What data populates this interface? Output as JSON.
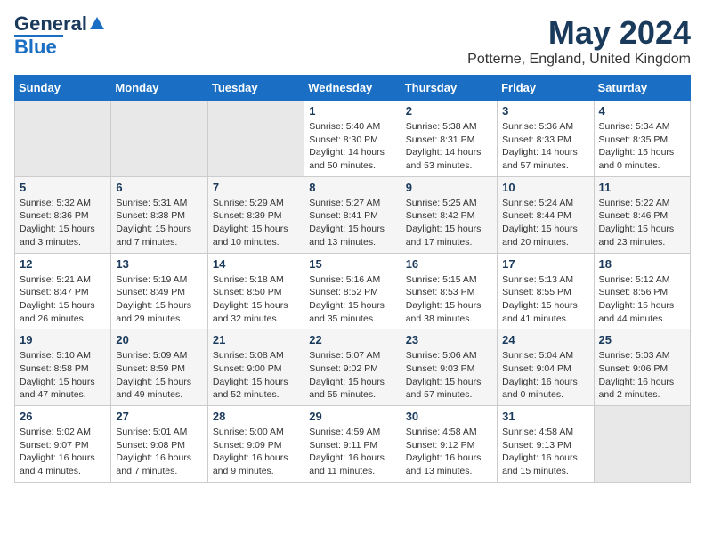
{
  "header": {
    "logo_line1": "General",
    "logo_line2": "Blue",
    "main_title": "May 2024",
    "subtitle": "Potterne, England, United Kingdom"
  },
  "calendar": {
    "days_of_week": [
      "Sunday",
      "Monday",
      "Tuesday",
      "Wednesday",
      "Thursday",
      "Friday",
      "Saturday"
    ],
    "weeks": [
      [
        {
          "day": "",
          "info": ""
        },
        {
          "day": "",
          "info": ""
        },
        {
          "day": "",
          "info": ""
        },
        {
          "day": "1",
          "info": "Sunrise: 5:40 AM\nSunset: 8:30 PM\nDaylight: 14 hours\nand 50 minutes."
        },
        {
          "day": "2",
          "info": "Sunrise: 5:38 AM\nSunset: 8:31 PM\nDaylight: 14 hours\nand 53 minutes."
        },
        {
          "day": "3",
          "info": "Sunrise: 5:36 AM\nSunset: 8:33 PM\nDaylight: 14 hours\nand 57 minutes."
        },
        {
          "day": "4",
          "info": "Sunrise: 5:34 AM\nSunset: 8:35 PM\nDaylight: 15 hours\nand 0 minutes."
        }
      ],
      [
        {
          "day": "5",
          "info": "Sunrise: 5:32 AM\nSunset: 8:36 PM\nDaylight: 15 hours\nand 3 minutes."
        },
        {
          "day": "6",
          "info": "Sunrise: 5:31 AM\nSunset: 8:38 PM\nDaylight: 15 hours\nand 7 minutes."
        },
        {
          "day": "7",
          "info": "Sunrise: 5:29 AM\nSunset: 8:39 PM\nDaylight: 15 hours\nand 10 minutes."
        },
        {
          "day": "8",
          "info": "Sunrise: 5:27 AM\nSunset: 8:41 PM\nDaylight: 15 hours\nand 13 minutes."
        },
        {
          "day": "9",
          "info": "Sunrise: 5:25 AM\nSunset: 8:42 PM\nDaylight: 15 hours\nand 17 minutes."
        },
        {
          "day": "10",
          "info": "Sunrise: 5:24 AM\nSunset: 8:44 PM\nDaylight: 15 hours\nand 20 minutes."
        },
        {
          "day": "11",
          "info": "Sunrise: 5:22 AM\nSunset: 8:46 PM\nDaylight: 15 hours\nand 23 minutes."
        }
      ],
      [
        {
          "day": "12",
          "info": "Sunrise: 5:21 AM\nSunset: 8:47 PM\nDaylight: 15 hours\nand 26 minutes."
        },
        {
          "day": "13",
          "info": "Sunrise: 5:19 AM\nSunset: 8:49 PM\nDaylight: 15 hours\nand 29 minutes."
        },
        {
          "day": "14",
          "info": "Sunrise: 5:18 AM\nSunset: 8:50 PM\nDaylight: 15 hours\nand 32 minutes."
        },
        {
          "day": "15",
          "info": "Sunrise: 5:16 AM\nSunset: 8:52 PM\nDaylight: 15 hours\nand 35 minutes."
        },
        {
          "day": "16",
          "info": "Sunrise: 5:15 AM\nSunset: 8:53 PM\nDaylight: 15 hours\nand 38 minutes."
        },
        {
          "day": "17",
          "info": "Sunrise: 5:13 AM\nSunset: 8:55 PM\nDaylight: 15 hours\nand 41 minutes."
        },
        {
          "day": "18",
          "info": "Sunrise: 5:12 AM\nSunset: 8:56 PM\nDaylight: 15 hours\nand 44 minutes."
        }
      ],
      [
        {
          "day": "19",
          "info": "Sunrise: 5:10 AM\nSunset: 8:58 PM\nDaylight: 15 hours\nand 47 minutes."
        },
        {
          "day": "20",
          "info": "Sunrise: 5:09 AM\nSunset: 8:59 PM\nDaylight: 15 hours\nand 49 minutes."
        },
        {
          "day": "21",
          "info": "Sunrise: 5:08 AM\nSunset: 9:00 PM\nDaylight: 15 hours\nand 52 minutes."
        },
        {
          "day": "22",
          "info": "Sunrise: 5:07 AM\nSunset: 9:02 PM\nDaylight: 15 hours\nand 55 minutes."
        },
        {
          "day": "23",
          "info": "Sunrise: 5:06 AM\nSunset: 9:03 PM\nDaylight: 15 hours\nand 57 minutes."
        },
        {
          "day": "24",
          "info": "Sunrise: 5:04 AM\nSunset: 9:04 PM\nDaylight: 16 hours\nand 0 minutes."
        },
        {
          "day": "25",
          "info": "Sunrise: 5:03 AM\nSunset: 9:06 PM\nDaylight: 16 hours\nand 2 minutes."
        }
      ],
      [
        {
          "day": "26",
          "info": "Sunrise: 5:02 AM\nSunset: 9:07 PM\nDaylight: 16 hours\nand 4 minutes."
        },
        {
          "day": "27",
          "info": "Sunrise: 5:01 AM\nSunset: 9:08 PM\nDaylight: 16 hours\nand 7 minutes."
        },
        {
          "day": "28",
          "info": "Sunrise: 5:00 AM\nSunset: 9:09 PM\nDaylight: 16 hours\nand 9 minutes."
        },
        {
          "day": "29",
          "info": "Sunrise: 4:59 AM\nSunset: 9:11 PM\nDaylight: 16 hours\nand 11 minutes."
        },
        {
          "day": "30",
          "info": "Sunrise: 4:58 AM\nSunset: 9:12 PM\nDaylight: 16 hours\nand 13 minutes."
        },
        {
          "day": "31",
          "info": "Sunrise: 4:58 AM\nSunset: 9:13 PM\nDaylight: 16 hours\nand 15 minutes."
        },
        {
          "day": "",
          "info": ""
        }
      ]
    ]
  }
}
